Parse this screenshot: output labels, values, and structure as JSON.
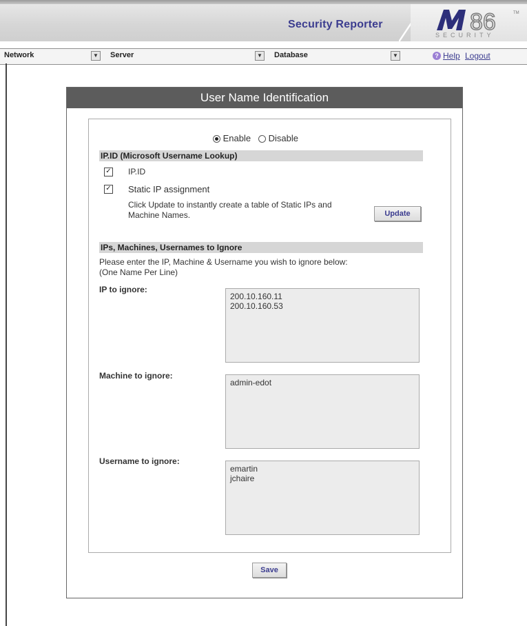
{
  "header": {
    "title": "Security Reporter",
    "logo_text": "SECURITY",
    "colors": {
      "brand": "#3b3c8f",
      "header_bar": "#5c5c5c",
      "section_bar": "#d6d6d6"
    }
  },
  "nav": {
    "items": [
      {
        "label": "Network"
      },
      {
        "label": "Server"
      },
      {
        "label": "Database"
      }
    ],
    "help_label": "Help",
    "logout_label": "Logout"
  },
  "panel": {
    "title": "User Name Identification",
    "mode": {
      "enable_label": "Enable",
      "disable_label": "Disable",
      "selected": "Enable"
    },
    "ipid_section": {
      "heading": "IP.ID (Microsoft Username Lookup)",
      "ipid_label": "IP.ID",
      "ipid_checked": true,
      "static_label": "Static IP assignment",
      "static_checked": true,
      "update_desc_line1": "Click Update to instantly create a table of Static IPs and",
      "update_desc_line2": "Machine Names.",
      "update_button": "Update"
    },
    "ignore_section": {
      "heading": "IPs, Machines, Usernames to Ignore",
      "instructions_line1": "Please enter the IP, Machine & Username you wish to ignore below:",
      "instructions_line2": "(One Name Per Line)",
      "ip_label": "IP to ignore:",
      "ip_values": [
        "200.10.160.11",
        "200.10.160.53"
      ],
      "machine_label": "Machine to ignore:",
      "machine_values": [
        "admin-edot"
      ],
      "username_label": "Username to ignore:",
      "username_values": [
        "emartin",
        "jchaire"
      ]
    },
    "save_button": "Save"
  }
}
